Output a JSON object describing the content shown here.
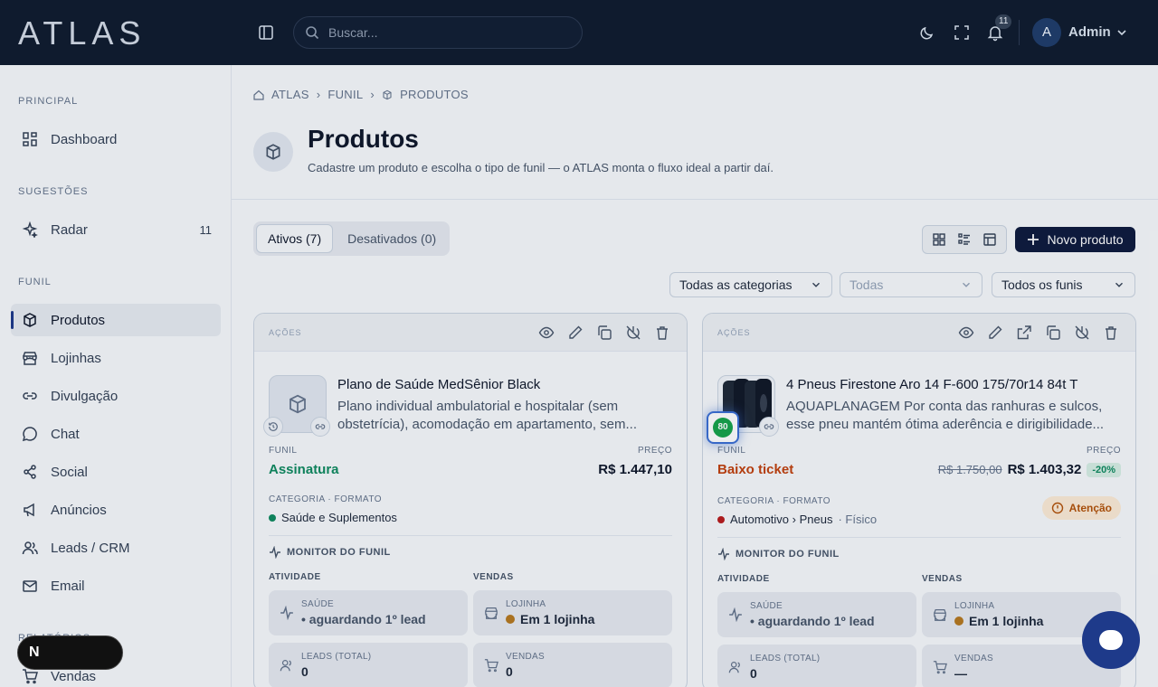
{
  "app": {
    "logo": "ATLAS"
  },
  "header": {
    "search_placeholder": "Buscar...",
    "notifications_count": "11",
    "user_initial": "A",
    "user_name": "Admin"
  },
  "sidebar": {
    "sections": [
      {
        "title": "PRINCIPAL",
        "items": [
          {
            "label": "Dashboard",
            "icon": "dashboard-icon"
          }
        ]
      },
      {
        "title": "SUGESTÕES",
        "items": [
          {
            "label": "Radar",
            "icon": "sparkles-icon",
            "count": "11"
          }
        ]
      },
      {
        "title": "FUNIL",
        "items": [
          {
            "label": "Produtos",
            "icon": "box-icon",
            "active": true
          },
          {
            "label": "Lojinhas",
            "icon": "store-icon"
          },
          {
            "label": "Divulgação",
            "icon": "link-icon"
          },
          {
            "label": "Chat",
            "icon": "chat-icon"
          },
          {
            "label": "Social",
            "icon": "share-icon"
          },
          {
            "label": "Anúncios",
            "icon": "megaphone-icon"
          },
          {
            "label": "Leads / CRM",
            "icon": "users-icon"
          },
          {
            "label": "Email",
            "icon": "mail-icon"
          }
        ]
      },
      {
        "title": "RELATÓRIOS",
        "items": [
          {
            "label": "Vendas",
            "icon": "cart-icon"
          }
        ]
      }
    ]
  },
  "breadcrumb": [
    "ATLAS",
    "FUNIL",
    "PRODUTOS"
  ],
  "page": {
    "title": "Produtos",
    "subtitle": "Cadastre um produto e escolha o tipo de funil — o ATLAS monta o fluxo ideal a partir daí."
  },
  "tabs": [
    {
      "label": "Ativos (7)",
      "active": true
    },
    {
      "label": "Desativados (0)"
    }
  ],
  "new_button": "Novo produto",
  "filters": [
    {
      "value": "Todas as categorias"
    },
    {
      "value": "Todas"
    },
    {
      "value": "Todos os funis"
    }
  ],
  "cards": [
    {
      "actions_label": "AÇÕES",
      "name": "Plano de Saúde MedSênior Black",
      "description": "Plano individual ambulatorial e hospitalar (sem obstetrícia), acomodação em apartamento, sem...",
      "funil_label": "FUNIL",
      "funil": "Assinatura",
      "funil_color": "#0f8a5f",
      "preco_label": "PREÇO",
      "price": "R$ 1.447,10",
      "category_label": "CATEGORIA · FORMATO",
      "category": "Saúde e Suplementos",
      "category_color": "#0f8a5f",
      "monitor_label": "MONITOR DO FUNIL",
      "activity_label": "ATIVIDADE",
      "sales_label": "VENDAS",
      "tiles": {
        "saude_label": "SAÚDE",
        "saude": "• aguardando 1º lead",
        "lojinha_label": "LOJINHA",
        "lojinha": "Em 1 lojinha",
        "leads_label": "LEADS (TOTAL)",
        "leads": "0",
        "vendas_label": "VENDAS",
        "vendas": "0"
      }
    },
    {
      "actions_label": "AÇÕES",
      "name": "4 Pneus Firestone Aro 14 F-600 175/70r14 84t T",
      "description": "AQUAPLANAGEM Por conta das ranhuras e sulcos, esse pneu mantém ótima aderência e dirigibilidade...",
      "funil_label": "FUNIL",
      "funil": "Baixo ticket",
      "funil_color": "#c2410c",
      "preco_label": "PREÇO",
      "old_price": "R$ 1.750,00",
      "price": "R$ 1.403,32",
      "discount": "-20%",
      "category_label": "CATEGORIA · FORMATO",
      "category": "Automotivo › Pneus",
      "format": "· Físico",
      "category_color": "#b91c1c",
      "warning": "Atenção",
      "score": "80",
      "monitor_label": "MONITOR DO FUNIL",
      "activity_label": "ATIVIDADE",
      "sales_label": "VENDAS",
      "tiles": {
        "saude_label": "SAÚDE",
        "saude": "• aguardando 1º lead",
        "lojinha_label": "LOJINHA",
        "lojinha": "Em 1 lojinha",
        "leads_label": "LEADS (TOTAL)",
        "leads": "0",
        "vendas_label": "VENDAS",
        "vendas": "—"
      }
    }
  ],
  "dev_badge": "N"
}
